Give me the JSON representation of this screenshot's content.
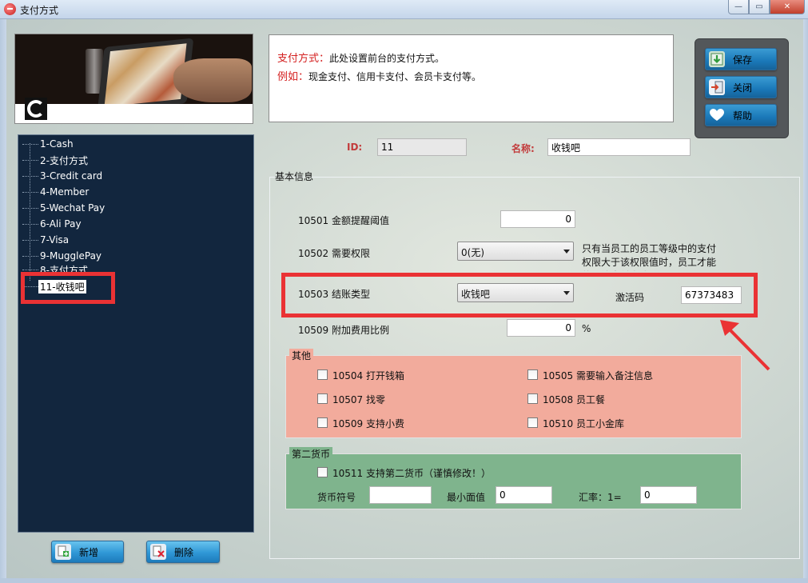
{
  "window": {
    "title": "支付方式",
    "controls": [
      "—",
      "▭",
      "✕"
    ]
  },
  "tree": {
    "items": [
      {
        "label": "1-Cash",
        "selected": false
      },
      {
        "label": "2-支付方式",
        "selected": false
      },
      {
        "label": "3-Credit card",
        "selected": false
      },
      {
        "label": "4-Member",
        "selected": false
      },
      {
        "label": "5-Wechat Pay",
        "selected": false
      },
      {
        "label": "6-Ali Pay",
        "selected": false
      },
      {
        "label": "7-Visa",
        "selected": false
      },
      {
        "label": "9-MugglePay",
        "selected": false
      },
      {
        "label": "8-支付方式",
        "selected": false
      },
      {
        "label": "11-收钱吧",
        "selected": true
      }
    ]
  },
  "bottom_buttons": {
    "add_label": "新增",
    "delete_label": "删除"
  },
  "side_buttons": {
    "save_label": "保存",
    "close_label": "关闭",
    "help_label": "帮助"
  },
  "description": {
    "line1_key": "支付方式：",
    "line1_text": "此处设置前台的支付方式。",
    "line2_key": "例如：",
    "line2_text": "现金支付、信用卡支付、会员卡支付等。"
  },
  "header_fields": {
    "id_label": "ID:",
    "id_value": "11",
    "name_label": "名称:",
    "name_value": "收钱吧"
  },
  "basic_info": {
    "title": "基本信息",
    "f10501_label": "10501 金额提醒阈值",
    "f10501_value": "0",
    "f10502_label": "10502 需要权限",
    "f10502_value": "0(无)",
    "f10502_note": "只有当员工的员工等级中的支付权限大于该权限值时，员工才能使用该支付方式。",
    "f10503_label": "10503 结账类型",
    "f10503_value": "收钱吧",
    "activation_label": "激活码",
    "activation_value": "67373483",
    "f10509_label": "10509 附加费用比例",
    "f10509_value": "0",
    "f10509_unit": "%"
  },
  "other": {
    "title": "其他",
    "options": [
      {
        "label": "10504 打开钱箱",
        "checked": false
      },
      {
        "label": "10505 需要输入备注信息",
        "checked": false
      },
      {
        "label": "10507 找零",
        "checked": false
      },
      {
        "label": "10508 员工餐",
        "checked": false
      },
      {
        "label": "10509 支持小费",
        "checked": false
      },
      {
        "label": "10510 员工小金库",
        "checked": false
      }
    ]
  },
  "second_currency": {
    "title": "第二货币",
    "enable_label": "10511 支持第二货币（谨慎修改！）",
    "symbol_label": "货币符号",
    "symbol_value": "",
    "min_label": "最小面值",
    "min_value": "0",
    "rate_label": "汇率：1=",
    "rate_value": "0"
  },
  "colors": {
    "tree_bg": "#12263e",
    "other_bg": "#f2ab9c",
    "second_bg": "#7fb48d",
    "highlight": "#ea3234",
    "button": "#2f97d6"
  }
}
